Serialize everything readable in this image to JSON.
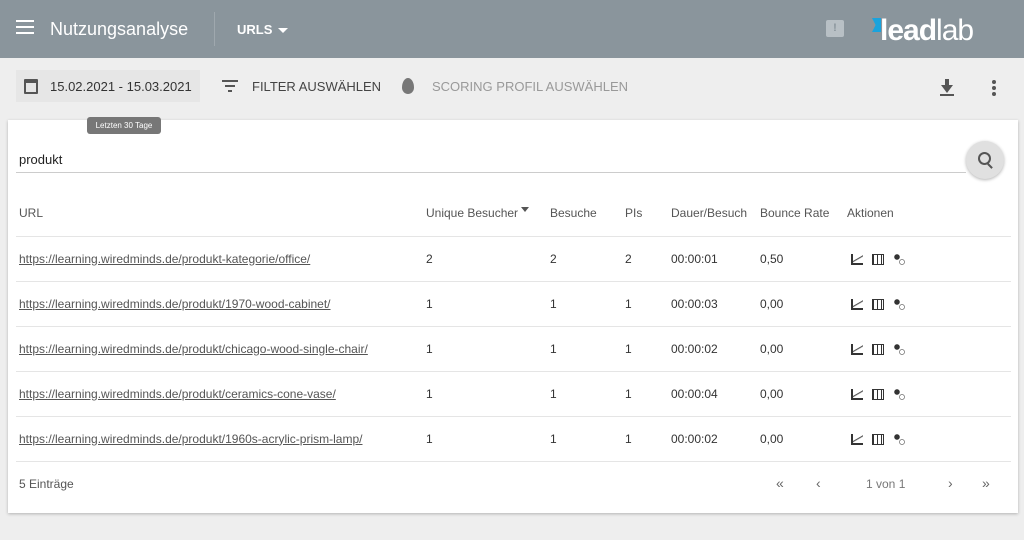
{
  "header": {
    "title": "Nutzungsanalyse",
    "section": "URLS",
    "logo_text_bold": "lead",
    "logo_text": "lab",
    "brand_color": "#1aa3dd"
  },
  "toolbar": {
    "date_range": "15.02.2021 - 15.03.2021",
    "filter": "FILTER AUSWÄHLEN",
    "scoring": "SCORING PROFIL AUSWÄHLEN",
    "tooltip": "Letzten 30 Tage"
  },
  "search": {
    "value": "produkt"
  },
  "table": {
    "columns": [
      "URL",
      "Unique Besucher",
      "Besuche",
      "PIs",
      "Dauer/Besuch",
      "Bounce Rate",
      "Aktionen"
    ],
    "sorted_column": "Unique Besucher",
    "rows": [
      {
        "url": "https://learning.wiredminds.de/produkt-kategorie/office/",
        "unique": "2",
        "visits": "2",
        "pis": "2",
        "duration": "00:00:01",
        "bounce": "0,50"
      },
      {
        "url": "https://learning.wiredminds.de/produkt/1970-wood-cabinet/",
        "unique": "1",
        "visits": "1",
        "pis": "1",
        "duration": "00:00:03",
        "bounce": "0,00"
      },
      {
        "url": "https://learning.wiredminds.de/produkt/chicago-wood-single-chair/",
        "unique": "1",
        "visits": "1",
        "pis": "1",
        "duration": "00:00:02",
        "bounce": "0,00"
      },
      {
        "url": "https://learning.wiredminds.de/produkt/ceramics-cone-vase/",
        "unique": "1",
        "visits": "1",
        "pis": "1",
        "duration": "00:00:04",
        "bounce": "0,00"
      },
      {
        "url": "https://learning.wiredminds.de/produkt/1960s-acrylic-prism-lamp/",
        "unique": "1",
        "visits": "1",
        "pis": "1",
        "duration": "00:00:02",
        "bounce": "0,00"
      }
    ]
  },
  "footer": {
    "count": "5 Einträge",
    "page": "1 von 1",
    "first": "«",
    "prev": "‹",
    "next": "›",
    "last": "»"
  }
}
